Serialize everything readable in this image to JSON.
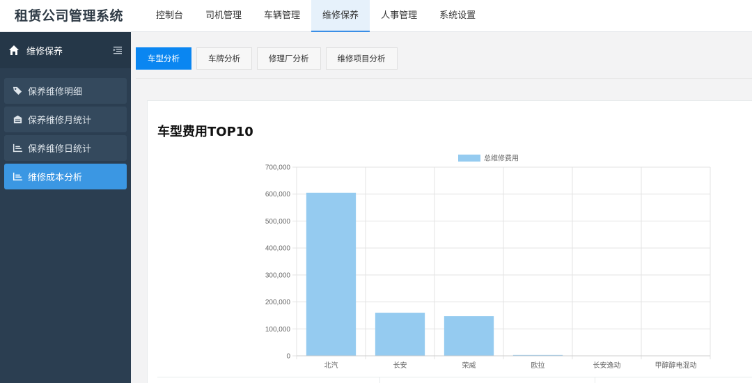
{
  "app": {
    "title": "租赁公司管理系统"
  },
  "topnav": {
    "items": [
      {
        "label": "控制台",
        "active": false
      },
      {
        "label": "司机管理",
        "active": false
      },
      {
        "label": "车辆管理",
        "active": false
      },
      {
        "label": "维修保养",
        "active": true
      },
      {
        "label": "人事管理",
        "active": false
      },
      {
        "label": "系统设置",
        "active": false
      }
    ]
  },
  "sidebar": {
    "title": "维修保养",
    "items": [
      {
        "label": "保养维修明细",
        "icon": "tags-icon",
        "active": false
      },
      {
        "label": "保养维修月统计",
        "icon": "calendar-icon",
        "active": false
      },
      {
        "label": "保养维修日统计",
        "icon": "bar-chart-icon",
        "active": false
      },
      {
        "label": "维修成本分析",
        "icon": "bar-chart-icon",
        "active": true
      }
    ]
  },
  "tabs": [
    {
      "label": "车型分析",
      "active": true
    },
    {
      "label": "车牌分析",
      "active": false
    },
    {
      "label": "修理厂分析",
      "active": false
    },
    {
      "label": "维修项目分析",
      "active": false
    }
  ],
  "colors": {
    "accent": "#0a86f1",
    "sidebar": "#2b3e51",
    "bar": "#95cbf0"
  },
  "chart_data": {
    "type": "bar",
    "title": "车型费用TOP10",
    "categories": [
      "北汽",
      "长安",
      "荣威",
      "欧拉",
      "长安逸动",
      "甲醇醇电混动"
    ],
    "series": [
      {
        "name": "总维修费用",
        "values": [
          605000,
          160000,
          147000,
          3000,
          800,
          500
        ]
      }
    ],
    "ylim": [
      0,
      700000
    ],
    "yticks": [
      "700,000",
      "600,000",
      "500,000",
      "400,000",
      "300,000",
      "200,000",
      "100,000",
      "0"
    ],
    "grid": true,
    "legend": "top"
  }
}
